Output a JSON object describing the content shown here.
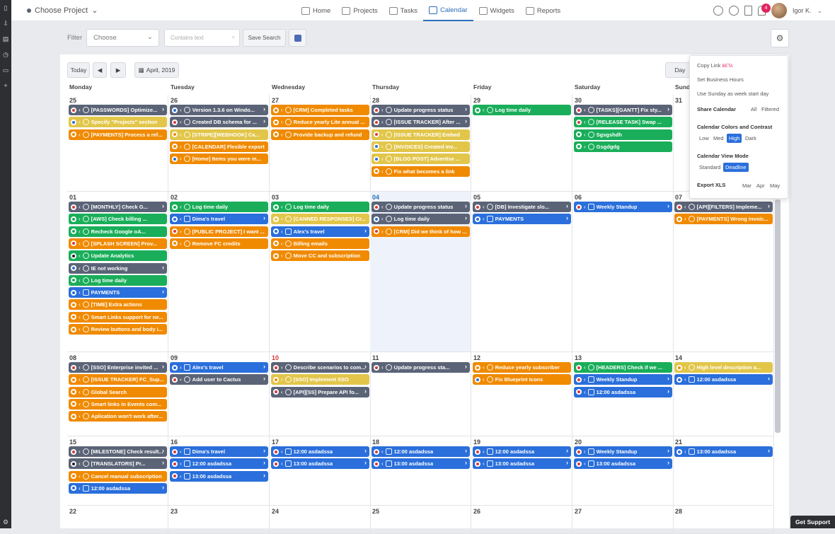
{
  "topbar": {
    "project": "Choose Project",
    "nav": [
      {
        "label": "Home",
        "icon": "home-icon"
      },
      {
        "label": "Projects",
        "icon": "projects-icon"
      },
      {
        "label": "Tasks",
        "icon": "tasks-icon"
      },
      {
        "label": "Calendar",
        "icon": "calendar-icon"
      },
      {
        "label": "Widgets",
        "icon": "widgets-icon"
      },
      {
        "label": "Reports",
        "icon": "reports-icon"
      }
    ],
    "notifications": "4",
    "user": "Igor K."
  },
  "filter": {
    "label": "Filter",
    "select": "Choose",
    "search_placeholder": "Contains text",
    "save": "Save Search"
  },
  "calendar": {
    "today_btn": "Today",
    "prev": "◀",
    "next": "▶",
    "month": "April, 2019",
    "view": "Day",
    "days": [
      "Monday",
      "Tuesday",
      "Wednesday",
      "Thursday",
      "Friday",
      "Saturday",
      "Sunday"
    ],
    "week1": {
      "dates": [
        "25",
        "26",
        "27",
        "28",
        "29",
        "30",
        "31"
      ],
      "mon": [
        "[PASSWORDS] Optimize...",
        "Specify \"Projects\" section",
        "[PAYMENTS] Process a ref..."
      ],
      "tue": [
        "Version 1.3.6 on Windo...",
        "Created DB schema for ...",
        "[STRIPE][WEBHOOK] Ca...",
        "[CALENDAR] Flexible export",
        "[Home] Items you were m..."
      ],
      "wed": [
        "[CRM] Completed tasks",
        "Reduce yearly Lite annual ...",
        "Provide backup and refund"
      ],
      "thu": [
        "Update progress status",
        "[ISSUE TRACKER] After ...",
        "[ISSUE TRACKER] Embed",
        "[INVOICES] Created inv...",
        "[BLOG POST] Advertise ...",
        "Fix what becomes a link"
      ],
      "fri": [
        "Log time daily"
      ],
      "sat": [
        "[TASKS][GANTT] Fix sty...",
        "[RELEASE TASK] Swap ...",
        "Sgsgshdh",
        "Gsgdgdg"
      ]
    },
    "week2": {
      "dates": [
        "01",
        "02",
        "03",
        "04",
        "05",
        "06",
        "07"
      ],
      "mon": [
        "[MONTHLY] Check G...",
        "[AWS] Check billing ...",
        "Recheck Google oA...",
        "[SPLASH SCREEN] Prov...",
        "Update Analytics",
        "IE not working",
        "Log time daily",
        "PAYMENTS",
        "[TIME] Extra actions",
        "Smart Links support for ne...",
        "Review buttons and body i..."
      ],
      "tue": [
        "Log time daily",
        "Dima's travel",
        "[PUBLIC PROJECT] I want ...",
        "Remove FC credits"
      ],
      "wed": [
        "Log time daily",
        "[CANNED RESPONSES] Cr...",
        "Alex's travel",
        "Billing emails",
        "Move CC and subscription"
      ],
      "thu": [
        "Update progress status",
        "Log time daily",
        "[CRM] Did we think of how ..."
      ],
      "fri": [
        "[DB] Investigate slo...",
        "PAYMENTS"
      ],
      "sat": [
        "Weekly Standup"
      ],
      "sun": [
        "[API][FILTERS] Impleme...",
        "[PAYMENTS] Wrong invoic..."
      ]
    },
    "week3": {
      "dates": [
        "08",
        "09",
        "10",
        "11",
        "12",
        "13",
        "14"
      ],
      "mon": [
        "[SSO] Enterprise invited ...",
        "[ISSUE TRACKER] FC_Sup...",
        "Global Search",
        "Smart links in Events com...",
        "Aplication won't work after..."
      ],
      "tue": [
        "Alex's travel",
        "Add user to Cactus"
      ],
      "wed": [
        "Describe scenarios to com...",
        "[SSO] Implement SSO",
        "[API][SS] Prepare API fo..."
      ],
      "thu": [
        "Update progress sta..."
      ],
      "fri": [
        "Reduce yearly subscriber",
        "Fix Blueprint Icons"
      ],
      "sat": [
        "[HEADERS] Check if we ...",
        "Weekly Standup",
        "12:00 asdadssa"
      ],
      "sun": [
        "High level description a...",
        "12:00 asdadssa"
      ]
    },
    "week4": {
      "dates": [
        "15",
        "16",
        "17",
        "18",
        "19",
        "20",
        "21"
      ],
      "mon": [
        "[MILESTONE] Check result...",
        "[TRANSLATORS] Pr...",
        "Cancel manual subscription",
        "12:00 asdadssa"
      ],
      "tue": [
        "Dima's travel",
        "12:00 asdadssa",
        "13:00 asdadssa"
      ],
      "wed": [
        "12:00 asdadssa",
        "13:00 asdadssa"
      ],
      "thu": [
        "12:00 asdadssa",
        "13:00 asdadssa"
      ],
      "fri": [
        "12:00 asdadssa",
        "13:00 asdadssa"
      ],
      "sat": [
        "Weekly Standup",
        "13:00 asdadssa"
      ],
      "sun": [
        "13:00 asdadssa"
      ]
    },
    "week5": {
      "dates": [
        "22",
        "23",
        "24",
        "25",
        "26",
        "27",
        "28"
      ]
    }
  },
  "settings_popup": {
    "copy_link": "Copy Link",
    "beta": "BETA",
    "business_hours": "Set Business Hours",
    "sunday_start": "Use Sunday as week start day",
    "share": "Share Calendar",
    "share_all": "All",
    "share_filtered": "Filtered",
    "colors_title": "Calendar Colors and Contrast",
    "contrast": [
      "Low",
      "Med",
      "High",
      "Dark"
    ],
    "view_mode_title": "Calendar View Mode",
    "view_modes": [
      "Standard",
      "Deadline"
    ],
    "export": "Export XLS",
    "export_months": [
      "Mar",
      "Apr",
      "May"
    ]
  },
  "support": "Get Support"
}
